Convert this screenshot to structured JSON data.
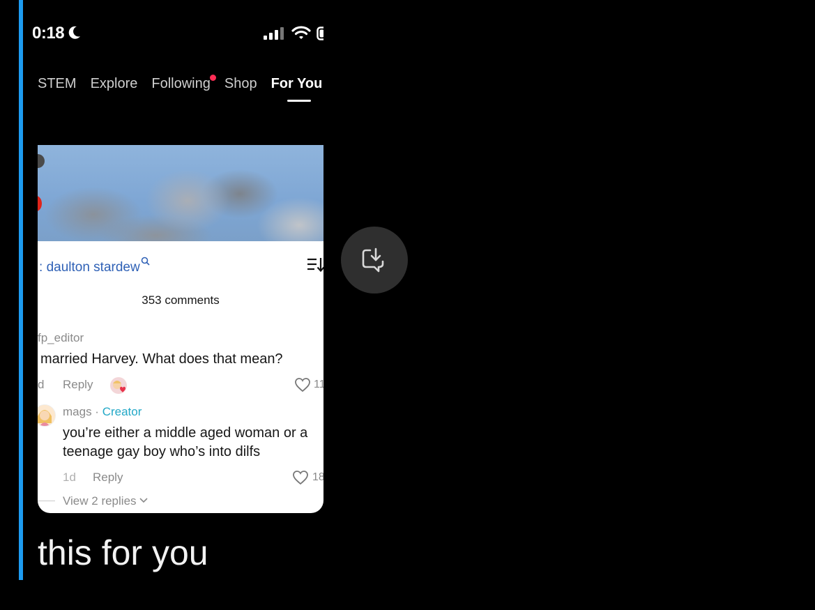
{
  "status_bar": {
    "time": "0:18"
  },
  "tabs": [
    {
      "label": "STEM"
    },
    {
      "label": "Explore"
    },
    {
      "label": "Following",
      "notification": true
    },
    {
      "label": "Shop"
    },
    {
      "label": "For You",
      "active": true
    }
  ],
  "comment_panel": {
    "search_prefix": ":",
    "search_text": "daulton stardew",
    "comments_count": "353 comments",
    "comments": [
      {
        "username": "fp_editor",
        "text": "married Harvey. What does that mean?",
        "age": "d",
        "reply_label": "Reply",
        "likes": "11"
      },
      {
        "username": "mags",
        "separator": " · ",
        "badge": "Creator",
        "text_line1": "you’re either a middle aged woman or a",
        "text_line2": "teenage gay boy who’s into dilfs",
        "age": "1d",
        "reply_label": "Reply",
        "likes": "18",
        "view_replies": "View 2 replies"
      }
    ]
  },
  "caption": "this for you",
  "colors": {
    "accent_bar": "#1d9bf0",
    "link": "#2f61b6",
    "creator_badge": "#23a8c7",
    "notification_dot": "#ff2d55"
  },
  "icons": [
    "moon-icon",
    "signal-icon",
    "wifi-icon",
    "battery-icon",
    "sort-icon",
    "search-icon",
    "heart-icon",
    "chevron-down-icon",
    "download-icon"
  ]
}
